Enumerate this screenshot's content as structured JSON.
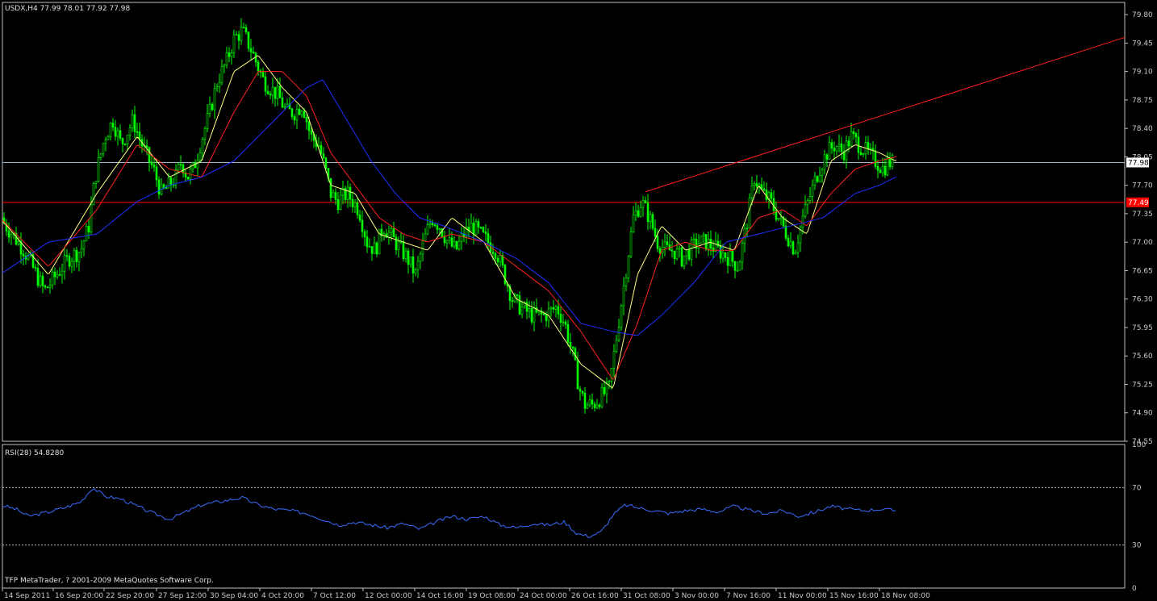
{
  "header": {
    "symbol_title": "USDX,H4  77.99 78.01 77.92 77.98",
    "rsi_title": "RSI(28) 54.8280",
    "copyright": "TFP MetaTrader, ? 2001-2009 MetaQuotes Software Corp."
  },
  "colors": {
    "background": "#000000",
    "frame": "#c0c0c0",
    "candle": "#00ff00",
    "ma_fast": "#ffff80",
    "ma_mid": "#ff2020",
    "ma_slow": "#2030ff",
    "rsi_line": "#3a6cff",
    "trendline": "#ff2020",
    "bid_line": "#a0b8d8",
    "price_marker_bg": "#ffffff",
    "level_marker_bg": "#ff0000"
  },
  "chart_data": [
    {
      "type": "candlestick",
      "title": "USDX,H4",
      "ohlc_last": {
        "open": 77.99,
        "high": 78.01,
        "low": 77.92,
        "close": 77.98
      },
      "ylim": [
        74.55,
        79.95
      ],
      "y_ticks": [
        "79.80",
        "79.45",
        "79.10",
        "78.75",
        "78.40",
        "78.05",
        "77.70",
        "77.35",
        "77.00",
        "76.65",
        "76.30",
        "75.95",
        "75.60",
        "75.25",
        "74.90",
        "74.55"
      ],
      "x_ticks": [
        "14 Sep 2011",
        "16 Sep 20:00",
        "22 Sep 20:00",
        "27 Sep 12:00",
        "30 Sep 04:00",
        "4 Oct 20:00",
        "7 Oct 12:00",
        "12 Oct 00:00",
        "14 Oct 16:00",
        "19 Oct 08:00",
        "24 Oct 00:00",
        "26 Oct 16:00",
        "31 Oct 08:00",
        "3 Nov 00:00",
        "7 Nov 16:00",
        "11 Nov 00:00",
        "15 Nov 16:00",
        "18 Nov 08:00"
      ],
      "series": [
        {
          "type": "candles",
          "anchor_x": [
            0,
            30,
            55,
            85,
            100,
            110,
            118,
            130,
            140,
            150,
            160,
            165,
            172,
            180,
            190,
            200,
            210,
            218,
            225,
            232,
            240,
            248,
            260,
            270,
            280,
            290,
            300,
            310,
            318,
            326,
            335,
            345,
            355,
            365,
            375,
            385,
            395,
            403,
            410,
            418,
            430,
            445,
            455,
            465,
            475,
            490,
            505,
            515,
            525,
            535,
            545,
            555,
            565,
            575,
            585,
            595,
            605,
            615,
            625,
            635,
            645,
            660,
            675,
            690,
            700,
            710,
            718,
            725,
            735,
            745,
            755,
            765,
            775,
            785,
            795,
            805,
            815,
            825,
            835,
            845,
            855,
            865,
            875,
            890,
            905,
            915,
            925,
            935,
            945,
            955,
            965,
            975,
            985,
            995,
            1005,
            1015,
            1025,
            1035,
            1045,
            1055,
            1065,
            1075,
            1085,
            1095,
            1100
          ],
          "anchor_close": [
            77.3,
            76.9,
            76.4,
            76.8,
            76.9,
            77.2,
            77.8,
            78.3,
            78.5,
            78.2,
            78.4,
            78.5,
            78.3,
            78.1,
            77.9,
            77.6,
            77.7,
            77.8,
            78.0,
            77.8,
            77.9,
            78.2,
            78.6,
            79.0,
            79.2,
            79.5,
            79.6,
            79.4,
            79.2,
            79.0,
            78.9,
            78.8,
            78.6,
            78.6,
            78.7,
            78.3,
            78.2,
            77.9,
            77.6,
            77.5,
            77.6,
            77.4,
            77.0,
            76.9,
            77.2,
            77.0,
            76.8,
            76.6,
            77.0,
            77.3,
            77.2,
            77.0,
            76.9,
            77.1,
            77.2,
            77.1,
            77.0,
            76.9,
            76.6,
            76.3,
            76.2,
            76.1,
            76.1,
            76.2,
            76.0,
            75.6,
            75.2,
            75.0,
            75.0,
            75.1,
            75.2,
            75.9,
            76.6,
            77.3,
            77.5,
            77.3,
            77.0,
            76.9,
            76.9,
            76.8,
            76.9,
            77.0,
            77.0,
            76.9,
            76.8,
            76.7,
            77.2,
            77.8,
            77.6,
            77.5,
            77.3,
            77.1,
            76.9,
            77.3,
            77.6,
            77.9,
            78.1,
            78.2,
            78.1,
            78.3,
            78.2,
            78.1,
            78.0,
            77.9,
            77.98
          ]
        },
        {
          "type": "line",
          "anchor_x": [
            0,
            60,
            120,
            170,
            210,
            250,
            290,
            320,
            350,
            380,
            410,
            440,
            470,
            500,
            530,
            560,
            600,
            640,
            680,
            720,
            760,
            790,
            820,
            850,
            880,
            910,
            940,
            970,
            1000,
            1030,
            1060,
            1090,
            1110
          ],
          "values": [
            77.3,
            76.6,
            77.6,
            78.3,
            77.8,
            78.0,
            79.1,
            79.3,
            78.9,
            78.6,
            77.7,
            77.6,
            77.1,
            77.0,
            76.9,
            77.3,
            77.0,
            76.3,
            76.1,
            75.5,
            75.2,
            76.6,
            77.2,
            76.9,
            77.0,
            76.9,
            77.7,
            77.3,
            77.1,
            78.0,
            78.2,
            78.1,
            78.0
          ]
        },
        {
          "type": "line",
          "anchor_x": [
            0,
            60,
            120,
            170,
            210,
            250,
            290,
            320,
            350,
            380,
            410,
            440,
            470,
            500,
            530,
            560,
            600,
            640,
            680,
            720,
            760,
            790,
            820,
            850,
            880,
            910,
            940,
            970,
            1000,
            1030,
            1060,
            1090,
            1110
          ],
          "values": [
            77.3,
            76.7,
            77.4,
            78.2,
            77.9,
            77.8,
            78.6,
            79.1,
            79.1,
            78.8,
            78.1,
            77.7,
            77.3,
            77.1,
            77.0,
            77.1,
            77.0,
            76.7,
            76.4,
            75.9,
            75.3,
            76.0,
            76.9,
            77.0,
            76.9,
            76.9,
            77.3,
            77.4,
            77.2,
            77.6,
            77.9,
            78.0,
            78.05
          ]
        },
        {
          "type": "line",
          "anchor_x": [
            0,
            60,
            120,
            170,
            210,
            250,
            290,
            320,
            350,
            380,
            400,
            430,
            460,
            490,
            520,
            550,
            600,
            640,
            680,
            720,
            760,
            790,
            820,
            860,
            900,
            940,
            980,
            1020,
            1060,
            1090,
            1110
          ],
          "values": [
            76.6,
            77.0,
            77.1,
            77.5,
            77.7,
            77.8,
            78.0,
            78.3,
            78.6,
            78.9,
            79.0,
            78.5,
            78.0,
            77.6,
            77.3,
            77.2,
            77.0,
            76.8,
            76.5,
            76.0,
            75.9,
            75.85,
            76.1,
            76.5,
            77.0,
            77.1,
            77.2,
            77.3,
            77.6,
            77.7,
            77.8
          ]
        }
      ],
      "horizontal_levels": [
        {
          "label": "77.98",
          "value": 77.98
        },
        {
          "label": "77.49",
          "value": 77.49
        }
      ],
      "trendline": {
        "from": [
          "31 Oct 08:00",
          77.62
        ],
        "to": [
          "right-edge",
          79.52
        ]
      }
    },
    {
      "type": "line",
      "title": "RSI(28) 54.8280",
      "ylim": [
        0,
        100
      ],
      "y_ticks": [
        "100",
        "70",
        "30",
        "0"
      ],
      "levels": [
        70,
        30
      ],
      "anchor_x": [
        0,
        20,
        35,
        60,
        80,
        100,
        115,
        130,
        150,
        170,
        190,
        210,
        230,
        250,
        270,
        300,
        320,
        340,
        360,
        380,
        400,
        420,
        440,
        460,
        480,
        500,
        520,
        540,
        560,
        580,
        600,
        620,
        640,
        660,
        680,
        700,
        715,
        730,
        745,
        760,
        775,
        790,
        810,
        830,
        850,
        870,
        890,
        910,
        930,
        950,
        970,
        990,
        1010,
        1030,
        1050,
        1070,
        1090,
        1110
      ],
      "values": [
        58,
        55,
        50,
        53,
        56,
        60,
        70,
        64,
        62,
        57,
        52,
        48,
        53,
        58,
        60,
        63,
        58,
        55,
        54,
        52,
        48,
        44,
        46,
        44,
        42,
        45,
        41,
        46,
        50,
        48,
        50,
        44,
        42,
        45,
        44,
        46,
        38,
        36,
        39,
        51,
        58,
        56,
        54,
        52,
        54,
        55,
        53,
        57,
        54,
        52,
        54,
        50,
        53,
        57,
        55,
        54,
        55,
        54
      ]
    }
  ]
}
